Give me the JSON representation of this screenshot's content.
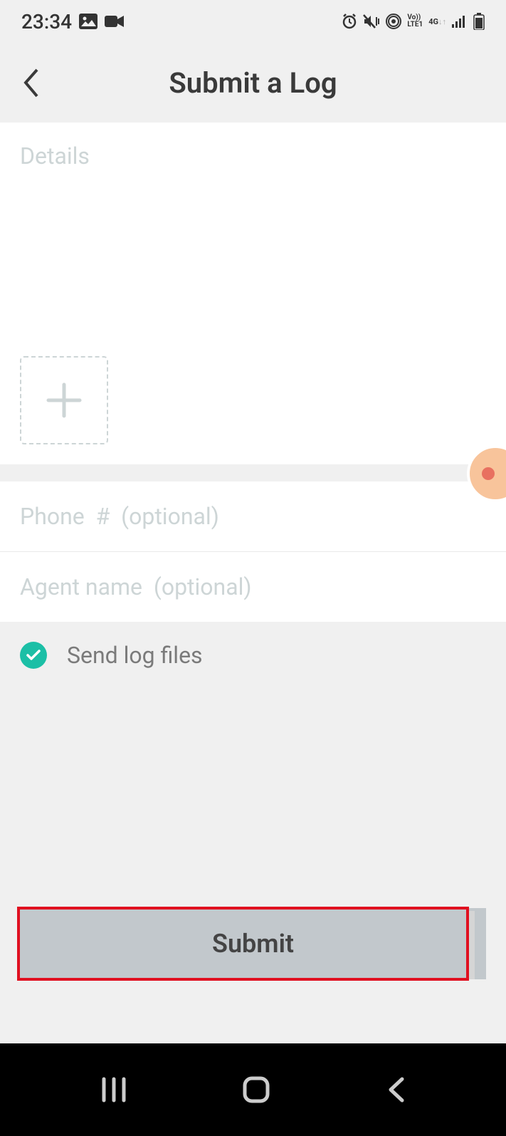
{
  "statusBar": {
    "time": "23:34"
  },
  "header": {
    "title": "Submit a Log"
  },
  "form": {
    "detailsPlaceholder": "Details",
    "phonePlaceholder": "Phone  #  (optional)",
    "agentPlaceholder": "Agent name  (optional)",
    "sendLogsLabel": "Send log files",
    "submitLabel": "Submit"
  }
}
